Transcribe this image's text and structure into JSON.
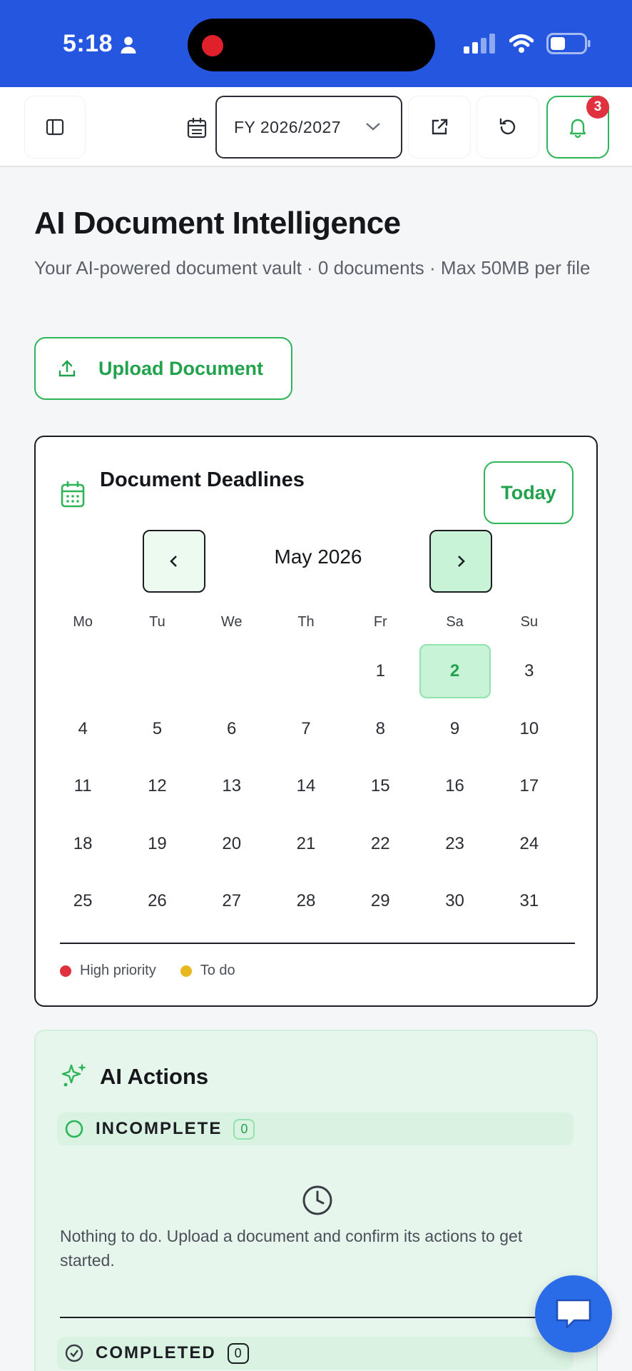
{
  "status_bar": {
    "time": "5:18"
  },
  "toolbar": {
    "fiscal_year": "FY 2026/2027",
    "notification_count": "3"
  },
  "page": {
    "title": "AI Document Intelligence",
    "subtitle": "Your AI-powered document vault · 0 documents · Max 50MB per file",
    "upload_label": "Upload Document"
  },
  "calendar": {
    "title": "Document Deadlines",
    "today_label": "Today",
    "month_label": "May 2026",
    "weekdays": [
      "Mo",
      "Tu",
      "We",
      "Th",
      "Fr",
      "Sa",
      "Su"
    ],
    "days": [
      "",
      "",
      "",
      "",
      "1",
      "2",
      "3",
      "4",
      "5",
      "6",
      "7",
      "8",
      "9",
      "10",
      "11",
      "12",
      "13",
      "14",
      "15",
      "16",
      "17",
      "18",
      "19",
      "20",
      "21",
      "22",
      "23",
      "24",
      "25",
      "26",
      "27",
      "28",
      "29",
      "30",
      "31"
    ],
    "today": "2",
    "legend": [
      {
        "label": "High priority",
        "color": "#e0313e"
      },
      {
        "label": "To do",
        "color": "#e9b820"
      }
    ]
  },
  "ai_actions": {
    "title": "AI Actions",
    "incomplete_label": "INCOMPLETE",
    "incomplete_count": "0",
    "empty_message": "Nothing to do. Upload a document and confirm its actions to get started.",
    "completed_label": "COMPLETED",
    "completed_count": "0"
  },
  "colors": {
    "accent": "#2db558",
    "status_bar": "#2456e0",
    "fab": "#2a6be8"
  }
}
